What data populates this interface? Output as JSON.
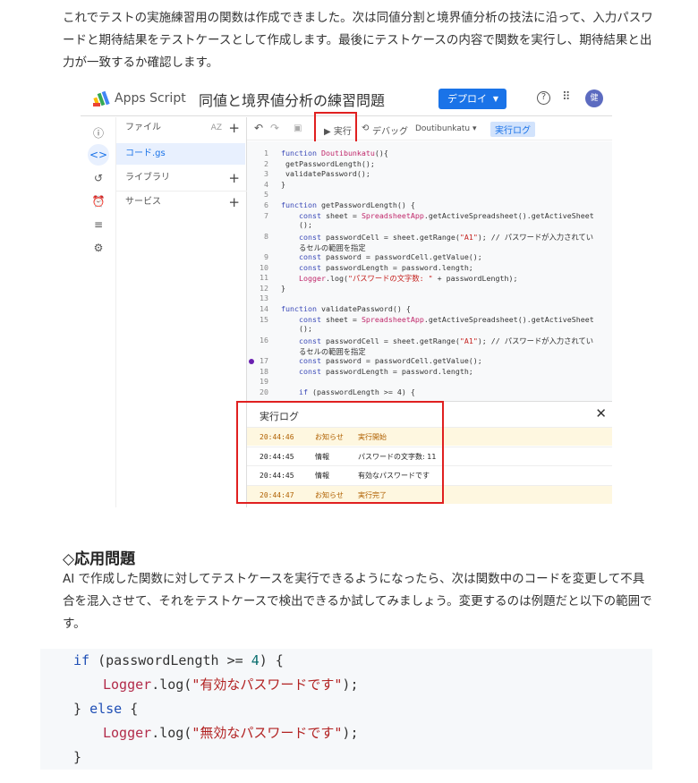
{
  "intro": "これでテストの実施練習用の関数は作成できました。次は同値分割と境界値分析の技法に沿って、入力パスワードと期待結果をテストケースとして作成します。最後にテストケースの内容で関数を実行し、期待結果と出力が一致するか確認します。",
  "screenshot": {
    "app_name": "Apps Script",
    "project_title": "同値と境界値分析の練習問題",
    "deploy_label": "デプロイ",
    "avatar": "健",
    "files_label": "ファイル",
    "file_name": "コード.gs",
    "libraries_label": "ライブラリ",
    "services_label": "サービス",
    "sort_label": "AZ",
    "run_label": "▶ 実行",
    "debug_label": "デバッグ",
    "function_select": "Doutibunkatu ▾",
    "exec_log_button": "実行ログ",
    "code_lines": [
      {
        "n": "1",
        "html": "<span class='kw'>function</span> <span class='fn'>Doutibunkatu</span>(){"
      },
      {
        "n": "2",
        "html": " getPasswordLength();"
      },
      {
        "n": "3",
        "html": " validatePassword();"
      },
      {
        "n": "4",
        "html": "}"
      },
      {
        "n": "5",
        "html": ""
      },
      {
        "n": "6",
        "html": "<span class='kw'>function</span> getPasswordLength() {"
      },
      {
        "n": "7",
        "html": "    <span class='kw'>const</span> sheet = <span class='fn'>SpreadsheetApp</span>.getActiveSpreadsheet().getActiveSheet\n    ();"
      },
      {
        "n": "8",
        "html": "    <span class='kw'>const</span> passwordCell = sheet.getRange(<span class='st'>\"A1\"</span>); // パスワードが入力されてい\n    るセルの範囲を指定"
      },
      {
        "n": "9",
        "html": "    <span class='kw'>const</span> password = passwordCell.getValue();"
      },
      {
        "n": "10",
        "html": "    <span class='kw'>const</span> passwordLength = password.length;"
      },
      {
        "n": "11",
        "html": "    <span class='fn'>Logger</span>.log(<span class='st'>\"パスワードの文字数: \"</span> + passwordLength);"
      },
      {
        "n": "12",
        "html": "}"
      },
      {
        "n": "13",
        "html": ""
      },
      {
        "n": "14",
        "html": "<span class='kw'>function</span> validatePassword() {"
      },
      {
        "n": "15",
        "html": "    <span class='kw'>const</span> sheet = <span class='fn'>SpreadsheetApp</span>.getActiveSpreadsheet().getActiveSheet\n    ();"
      },
      {
        "n": "16",
        "html": "    <span class='kw'>const</span> passwordCell = sheet.getRange(<span class='st'>\"A1\"</span>); // パスワードが入力されてい\n    るセルの範囲を指定"
      },
      {
        "n": "17",
        "html": "    <span class='kw'>const</span> password = passwordCell.getValue();"
      },
      {
        "n": "18",
        "html": "    <span class='kw'>const</span> passwordLength = password.length;"
      },
      {
        "n": "19",
        "html": ""
      },
      {
        "n": "20",
        "html": "    <span class='kw'>if</span> (passwordLength >= 4) {"
      }
    ],
    "log_title": "実行ログ",
    "log_rows": [
      {
        "time": "20:44:46",
        "level": "お知らせ",
        "msg": "実行開始"
      },
      {
        "time": "20:44:45",
        "level": "情報",
        "msg": "パスワードの文字数: 11"
      },
      {
        "time": "20:44:45",
        "level": "情報",
        "msg": "有効なパスワードです"
      },
      {
        "time": "20:44:47",
        "level": "お知らせ",
        "msg": "実行完了"
      }
    ]
  },
  "heading": "◇応用問題",
  "body": "AI で作成した関数に対してテストケースを実行できるようになったら、次は関数中のコードを変更して不具合を混入させて、それをテストケースで検出できるか試してみましょう。変更するのは例題だと以下の範囲です。",
  "code": {
    "l1a": "if",
    "l1b": " (passwordLength >= ",
    "l1c": "4",
    "l1d": ") {",
    "l2a": "Logger",
    "l2b": ".log(",
    "l2c": "\"有効なパスワードです\"",
    "l2d": ");",
    "l3a": "} ",
    "l3b": "else",
    "l3c": " {",
    "l4a": "Logger",
    "l4b": ".log(",
    "l4c": "\"無効なパスワードです\"",
    "l4d": ");",
    "l5": "}"
  }
}
